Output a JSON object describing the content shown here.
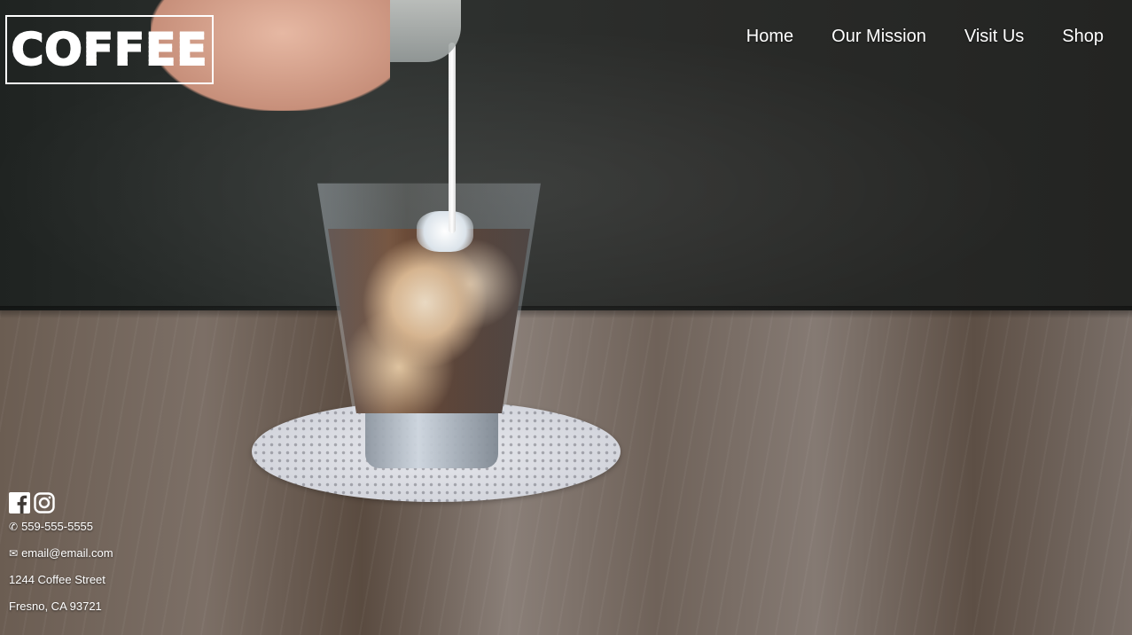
{
  "brand": {
    "logo_text": "COFFEE"
  },
  "nav": {
    "items": [
      {
        "label": "Home"
      },
      {
        "label": "Our Mission"
      },
      {
        "label": "Visit Us"
      },
      {
        "label": "Shop"
      }
    ]
  },
  "contact": {
    "social": [
      {
        "icon": "facebook-icon"
      },
      {
        "icon": "instagram-icon"
      }
    ],
    "phone_icon": "phone-icon",
    "phone": "559-555-5555",
    "email_icon": "envelope-icon",
    "email": "email@email.com",
    "street": "1244 Coffee Street",
    "city": "Fresno, CA 93721"
  }
}
